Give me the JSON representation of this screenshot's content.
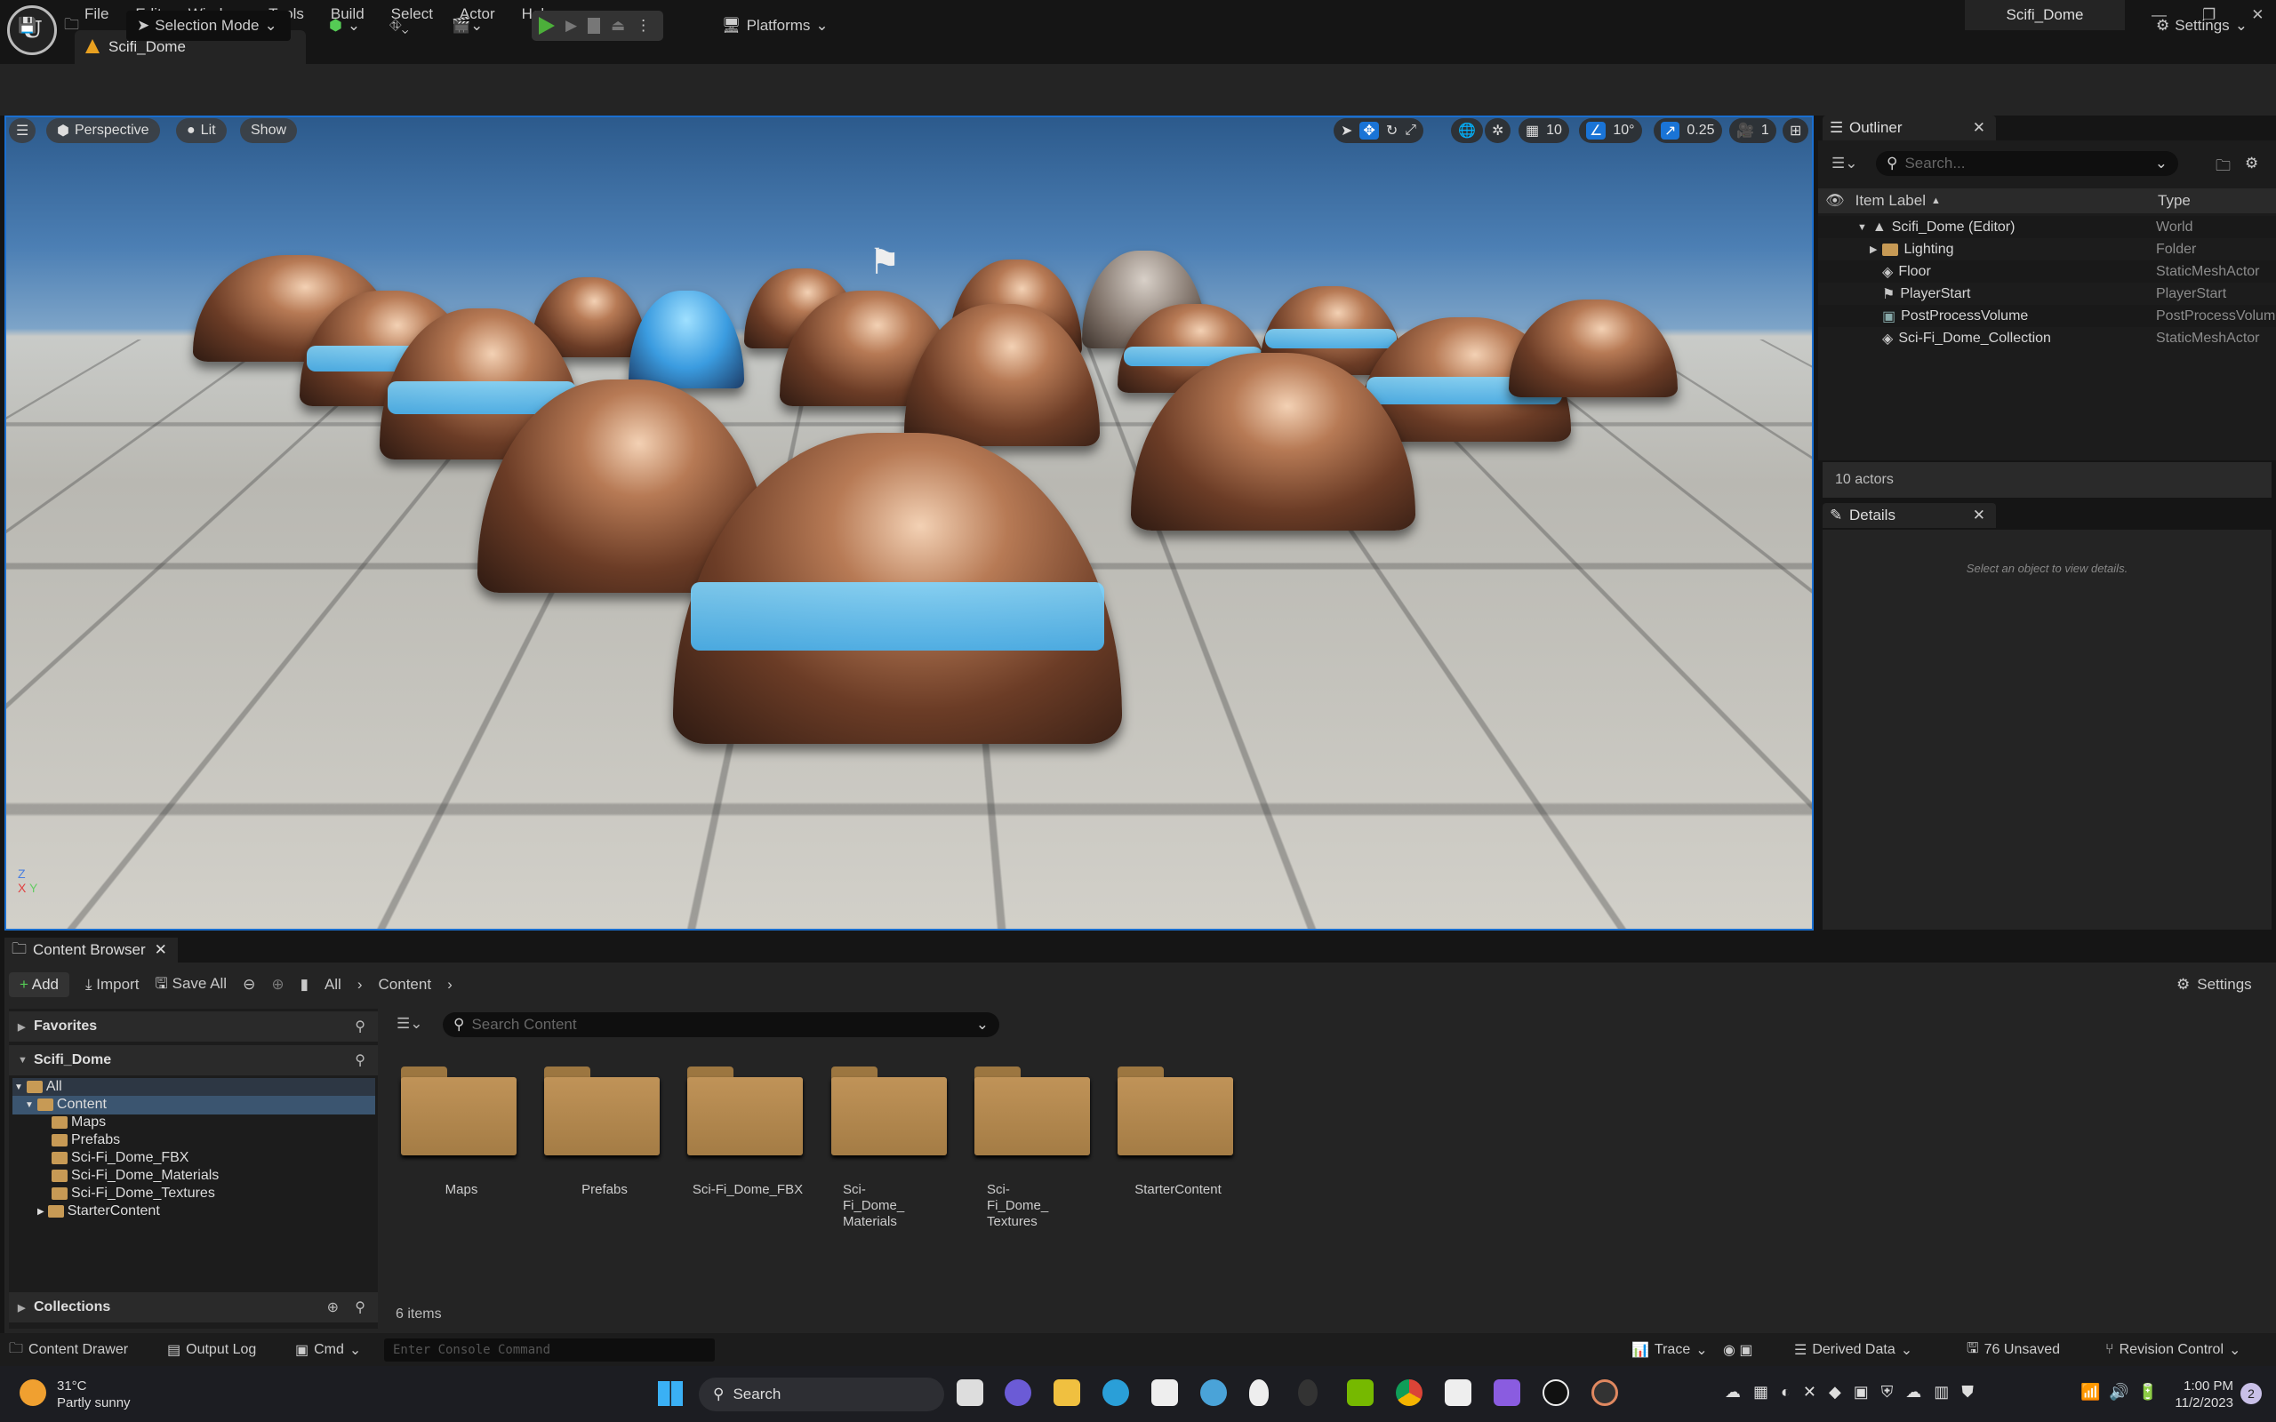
{
  "menu": [
    "File",
    "Edit",
    "Window",
    "Tools",
    "Build",
    "Select",
    "Actor",
    "Help"
  ],
  "level_tab": "Scifi_Dome",
  "window_title": "Scifi_Dome",
  "toolbar": {
    "selection_mode": "Selection Mode",
    "platforms": "Platforms",
    "settings": "Settings"
  },
  "viewport": {
    "perspective": "Perspective",
    "lit": "Lit",
    "show": "Show",
    "grid_snap": "10",
    "rotation_snap": "10°",
    "scale_snap": "0.25",
    "camera_speed": "1",
    "axis_z": "Z",
    "axis_y": "Y",
    "axis_x": "X"
  },
  "outliner": {
    "title": "Outliner",
    "search_placeholder": "Search...",
    "col_label": "Item Label",
    "col_type": "Type",
    "rows": [
      {
        "label": "Scifi_Dome (Editor)",
        "type": "World"
      },
      {
        "label": "Lighting",
        "type": "Folder"
      },
      {
        "label": "Floor",
        "type": "StaticMeshActor"
      },
      {
        "label": "PlayerStart",
        "type": "PlayerStart"
      },
      {
        "label": "PostProcessVolume",
        "type": "PostProcessVolume"
      },
      {
        "label": "Sci-Fi_Dome_Collection",
        "type": "StaticMeshActor"
      }
    ],
    "count": "10 actors"
  },
  "details": {
    "title": "Details",
    "hint": "Select an object to view details."
  },
  "content_browser": {
    "title": "Content Browser",
    "add": "Add",
    "import": "Import",
    "save_all": "Save All",
    "breadcrumb": [
      "All",
      "Content"
    ],
    "settings": "Settings",
    "favorites": "Favorites",
    "project": "Scifi_Dome",
    "collections": "Collections",
    "search_placeholder": "Search Content",
    "tree": [
      "All",
      "Content",
      "Maps",
      "Prefabs",
      "Sci-Fi_Dome_FBX",
      "Sci-Fi_Dome_Materials",
      "Sci-Fi_Dome_Textures",
      "StarterContent"
    ],
    "folders": [
      "Maps",
      "Prefabs",
      "Sci-Fi_Dome_FBX",
      "Sci-Fi_Dome_ Materials",
      "Sci-Fi_Dome_ Textures",
      "StarterContent"
    ],
    "item_count": "6 items"
  },
  "statusbar": {
    "content_drawer": "Content Drawer",
    "output_log": "Output Log",
    "cmd": "Cmd",
    "console_placeholder": "Enter Console Command",
    "trace": "Trace",
    "derived_data": "Derived Data",
    "unsaved": "76 Unsaved",
    "revision_control": "Revision Control"
  },
  "taskbar": {
    "temp": "31°C",
    "weather": "Partly sunny",
    "search": "Search",
    "time": "1:00 PM",
    "date": "11/2/2023",
    "notifications": "2"
  },
  "colors": {
    "accent": "#1a74d6",
    "play": "#4caf3a",
    "folder": "#b48a50"
  }
}
